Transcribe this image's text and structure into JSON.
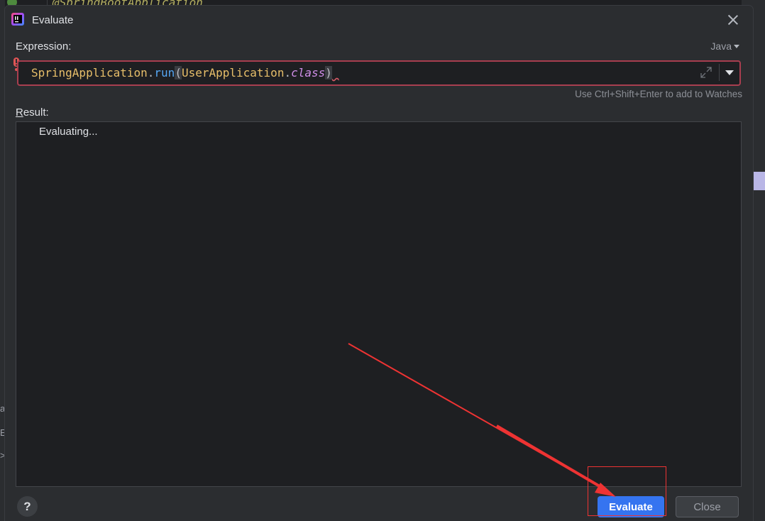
{
  "background": {
    "code_line": "@SpringBootApplication",
    "left_letters": [
      "a",
      "E",
      ">"
    ]
  },
  "dialog": {
    "title": "Evaluate",
    "expression_label": "Expression:",
    "language": "Java",
    "expression_tokens": {
      "t1": "SpringApplication",
      "t2": ".",
      "t3": "run",
      "t4": "(",
      "t5": "UserApplication",
      "t6": ".",
      "t7": "class",
      "t8": ")"
    },
    "hint": "Use Ctrl+Shift+Enter to add to Watches",
    "result_label_first": "R",
    "result_label_rest": "esult:",
    "result_text": "Evaluating...",
    "help_label": "?",
    "evaluate_label": "Evaluate",
    "close_label": "Close"
  },
  "colors": {
    "accent": "#3574f0",
    "error_border": "#a83e4f",
    "annotation": "#ee3333"
  },
  "icons": [
    "intellij-logo-icon",
    "close-icon",
    "chevron-down-icon",
    "error-icon",
    "expand-icon",
    "dropdown-arrow-icon",
    "help-icon"
  ]
}
